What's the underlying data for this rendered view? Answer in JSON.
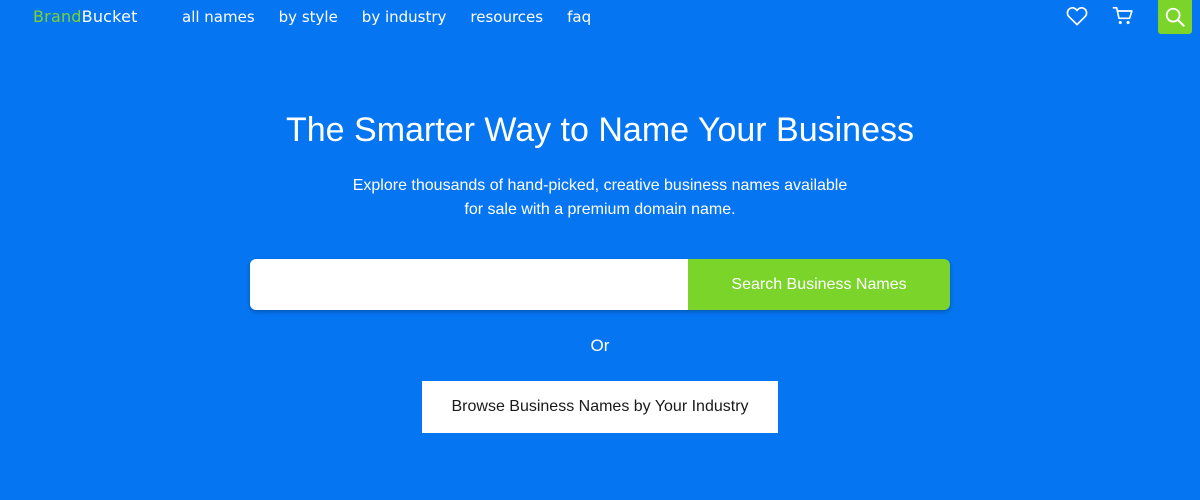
{
  "logo": {
    "part1": "Brand",
    "part2": "Bucket",
    "part1_color": "#7bd42a",
    "part2_color": "#ffffff"
  },
  "nav": {
    "items": [
      {
        "label": "all names"
      },
      {
        "label": "by style"
      },
      {
        "label": "by industry"
      },
      {
        "label": "resources"
      },
      {
        "label": "faq"
      }
    ]
  },
  "header_icons": {
    "favorites": "heart-icon",
    "cart": "cart-icon",
    "search": "search-icon"
  },
  "hero": {
    "title": "The Smarter Way to Name Your Business",
    "subtitle": "Explore thousands of hand-picked, creative business names available for sale with a premium domain name."
  },
  "search": {
    "value": "",
    "placeholder": "",
    "button_label": "Search Business Names"
  },
  "or_label": "Or",
  "browse": {
    "label": "Browse Business Names by Your Industry"
  },
  "colors": {
    "background": "#0575f2",
    "accent": "#7bd42a",
    "text": "#ffffff"
  }
}
